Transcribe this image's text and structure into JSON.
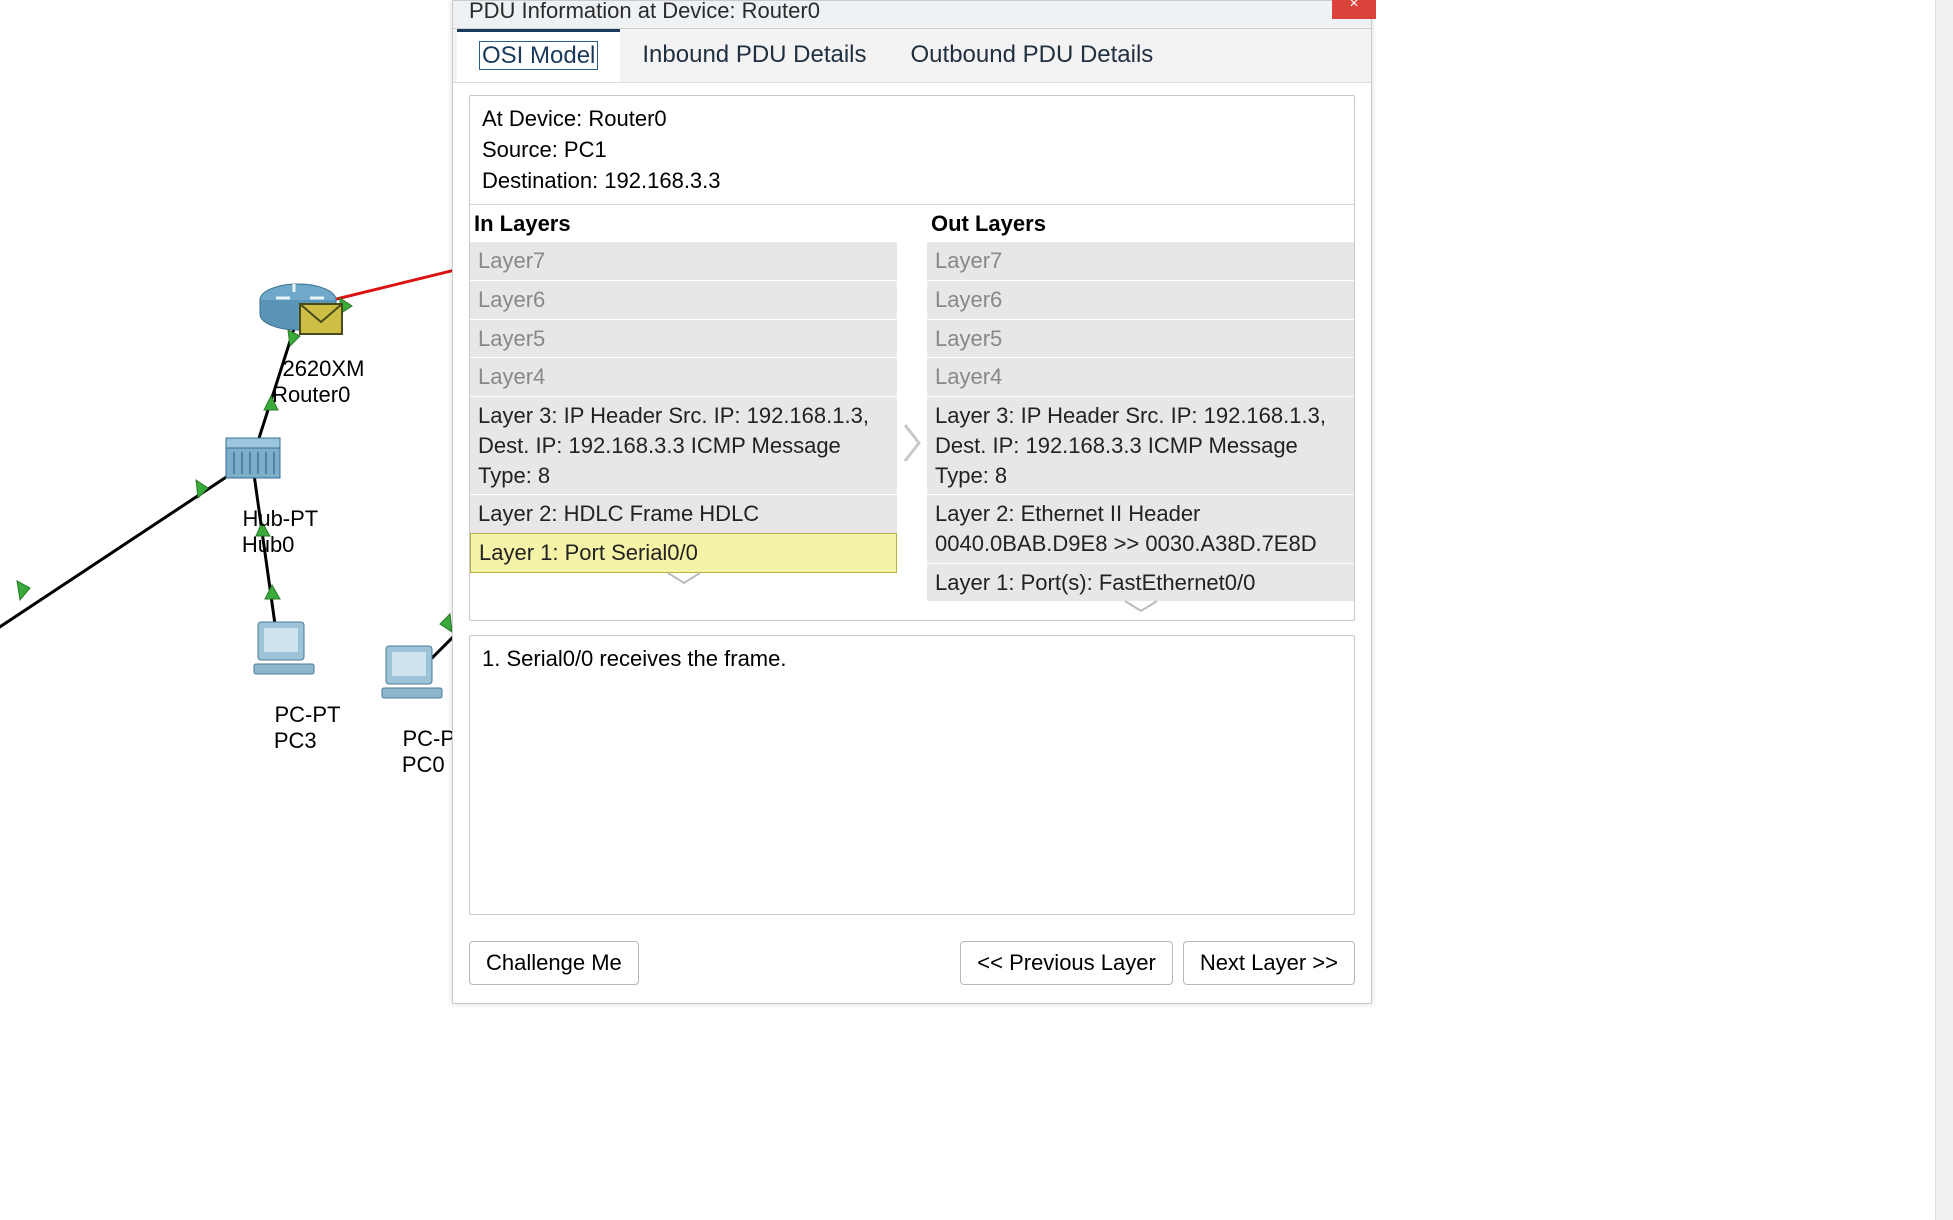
{
  "topology": {
    "router": {
      "model": "2620XM",
      "name": "Router0"
    },
    "hub": {
      "model": "Hub-PT",
      "name": "Hub0"
    },
    "pc3": {
      "model": "PC-PT",
      "name": "PC3"
    },
    "pc0": {
      "model": "PC-PT",
      "name": "PC0"
    }
  },
  "dialog": {
    "title": "PDU Information at Device: Router0",
    "close_label": "×",
    "tabs": {
      "osi": "OSI Model",
      "inbound": "Inbound PDU Details",
      "outbound": "Outbound PDU Details"
    },
    "info": {
      "at_device": "At Device: Router0",
      "source": "Source: PC1",
      "destination": "Destination: 192.168.3.3"
    },
    "in_heading": "In Layers",
    "out_heading": "Out Layers",
    "in_layers": {
      "l7": "Layer7",
      "l6": "Layer6",
      "l5": "Layer5",
      "l4": "Layer4",
      "l3": "Layer 3: IP Header Src. IP: 192.168.1.3, Dest. IP: 192.168.3.3 ICMP Message Type: 8",
      "l2": "Layer 2: HDLC Frame HDLC",
      "l1": "Layer 1: Port Serial0/0"
    },
    "out_layers": {
      "l7": "Layer7",
      "l6": "Layer6",
      "l5": "Layer5",
      "l4": "Layer4",
      "l3": "Layer 3: IP Header Src. IP: 192.168.1.3, Dest. IP: 192.168.3.3 ICMP Message Type: 8",
      "l2": "Layer 2: Ethernet II Header 0040.0BAB.D9E8 >> 0030.A38D.7E8D",
      "l1": "Layer 1: Port(s): FastEthernet0/0"
    },
    "detail_text": "1. Serial0/0 receives the frame.",
    "buttons": {
      "challenge": "Challenge Me",
      "prev": "<< Previous Layer",
      "next": "Next Layer >>"
    }
  }
}
